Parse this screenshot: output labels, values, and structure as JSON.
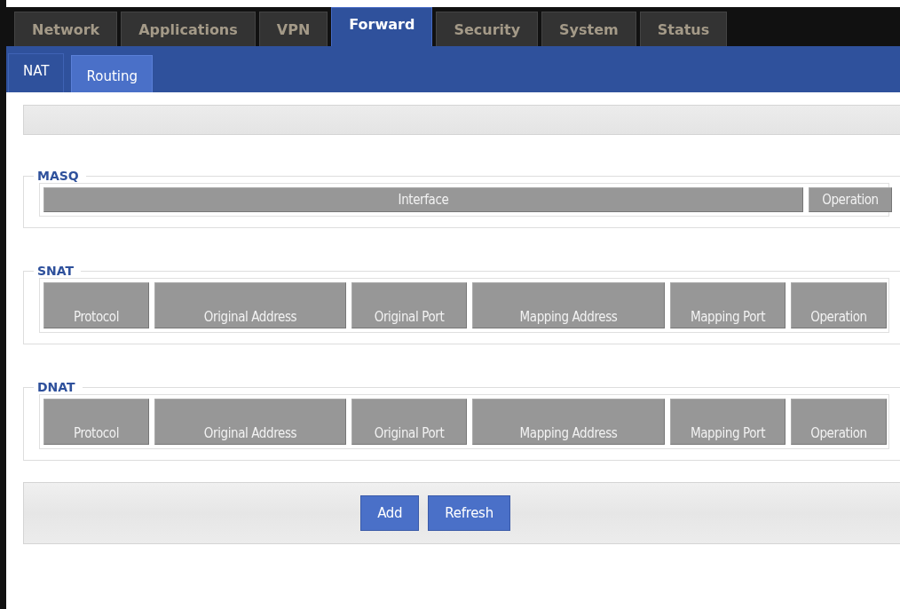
{
  "tabs": [
    {
      "label": "Network",
      "selected": false
    },
    {
      "label": "Applications",
      "selected": false
    },
    {
      "label": "VPN",
      "selected": false
    },
    {
      "label": "Forward",
      "selected": true
    },
    {
      "label": "Security",
      "selected": false
    },
    {
      "label": "System",
      "selected": false
    },
    {
      "label": "Status",
      "selected": false
    }
  ],
  "subtabs": [
    {
      "label": "NAT",
      "selected": false
    },
    {
      "label": "Routing",
      "selected": true
    }
  ],
  "sections": [
    {
      "legend": "MASQ",
      "columns": [
        "Interface",
        "Operation"
      ]
    },
    {
      "legend": "SNAT",
      "columns": [
        "Protocol",
        "Original Address",
        "Original Port",
        "Mapping Address",
        "Mapping Port",
        "Operation"
      ]
    },
    {
      "legend": "DNAT",
      "columns": [
        "Protocol",
        "Original Address",
        "Original Port",
        "Mapping Address",
        "Mapping Port",
        "Operation"
      ]
    }
  ],
  "buttons": [
    "Add",
    "Refresh"
  ]
}
